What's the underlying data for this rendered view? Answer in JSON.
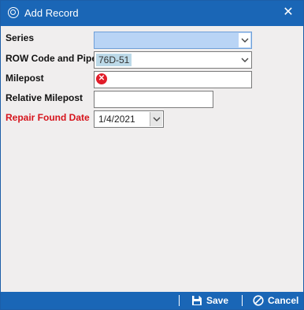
{
  "window": {
    "title": "Add Record",
    "close_glyph": "✕"
  },
  "form": {
    "series": {
      "label": "Series",
      "value": ""
    },
    "row_code": {
      "label": "ROW Code and Pipe",
      "tag": "76D-51"
    },
    "milepost": {
      "label": "Milepost",
      "value": "",
      "error_icon": "error-icon"
    },
    "relative_milepost": {
      "label": "Relative Milepost",
      "value": ""
    },
    "repair_found_date": {
      "label": "Repair Found Date",
      "value": "1/4/2021",
      "label_color": "#d6141c"
    }
  },
  "footer": {
    "save_label": "Save",
    "cancel_label": "Cancel"
  },
  "colors": {
    "titlebar": "#1a66b6",
    "selected_field": "#b9d4f5",
    "required_label": "#d6141c"
  }
}
